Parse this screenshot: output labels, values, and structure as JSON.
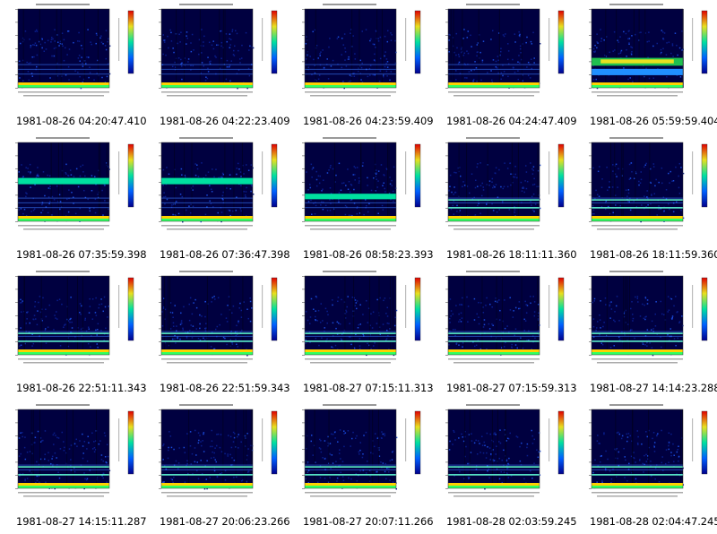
{
  "gallery": {
    "items": [
      {
        "caption": "1981-08-26 04:20:47.410",
        "band": "none"
      },
      {
        "caption": "1981-08-26 04:22:23.409",
        "band": "none"
      },
      {
        "caption": "1981-08-26 04:23:59.409",
        "band": "none"
      },
      {
        "caption": "1981-08-26 04:24:47.409",
        "band": "none"
      },
      {
        "caption": "1981-08-26 05:59:59.404",
        "band": "strong"
      },
      {
        "caption": "1981-08-26 07:35:59.398",
        "band": "mid"
      },
      {
        "caption": "1981-08-26 07:36:47.398",
        "band": "mid"
      },
      {
        "caption": "1981-08-26 08:58:23.393",
        "band": "low"
      },
      {
        "caption": "1981-08-26 18:11:11.360",
        "band": "faint"
      },
      {
        "caption": "1981-08-26 18:11:59.360",
        "band": "faint"
      },
      {
        "caption": "1981-08-26 22:51:11.343",
        "band": "faint"
      },
      {
        "caption": "1981-08-26 22:51:59.343",
        "band": "faint"
      },
      {
        "caption": "1981-08-27 07:15:11.313",
        "band": "faint"
      },
      {
        "caption": "1981-08-27 07:15:59.313",
        "band": "faint"
      },
      {
        "caption": "1981-08-27 14:14:23.288",
        "band": "faint"
      },
      {
        "caption": "1981-08-27 14:15:11.287",
        "band": "faint"
      },
      {
        "caption": "1981-08-27 20:06:23.266",
        "band": "faint"
      },
      {
        "caption": "1981-08-27 20:07:11.266",
        "band": "faint"
      },
      {
        "caption": "1981-08-28 02:03:59.245",
        "band": "faint"
      },
      {
        "caption": "1981-08-28 02:04:47.245",
        "band": "faint"
      }
    ]
  },
  "colors": {
    "background": "#000040",
    "noise": "#0a1e8c",
    "baseline": "#ffd000",
    "band": "#00e0a0"
  }
}
